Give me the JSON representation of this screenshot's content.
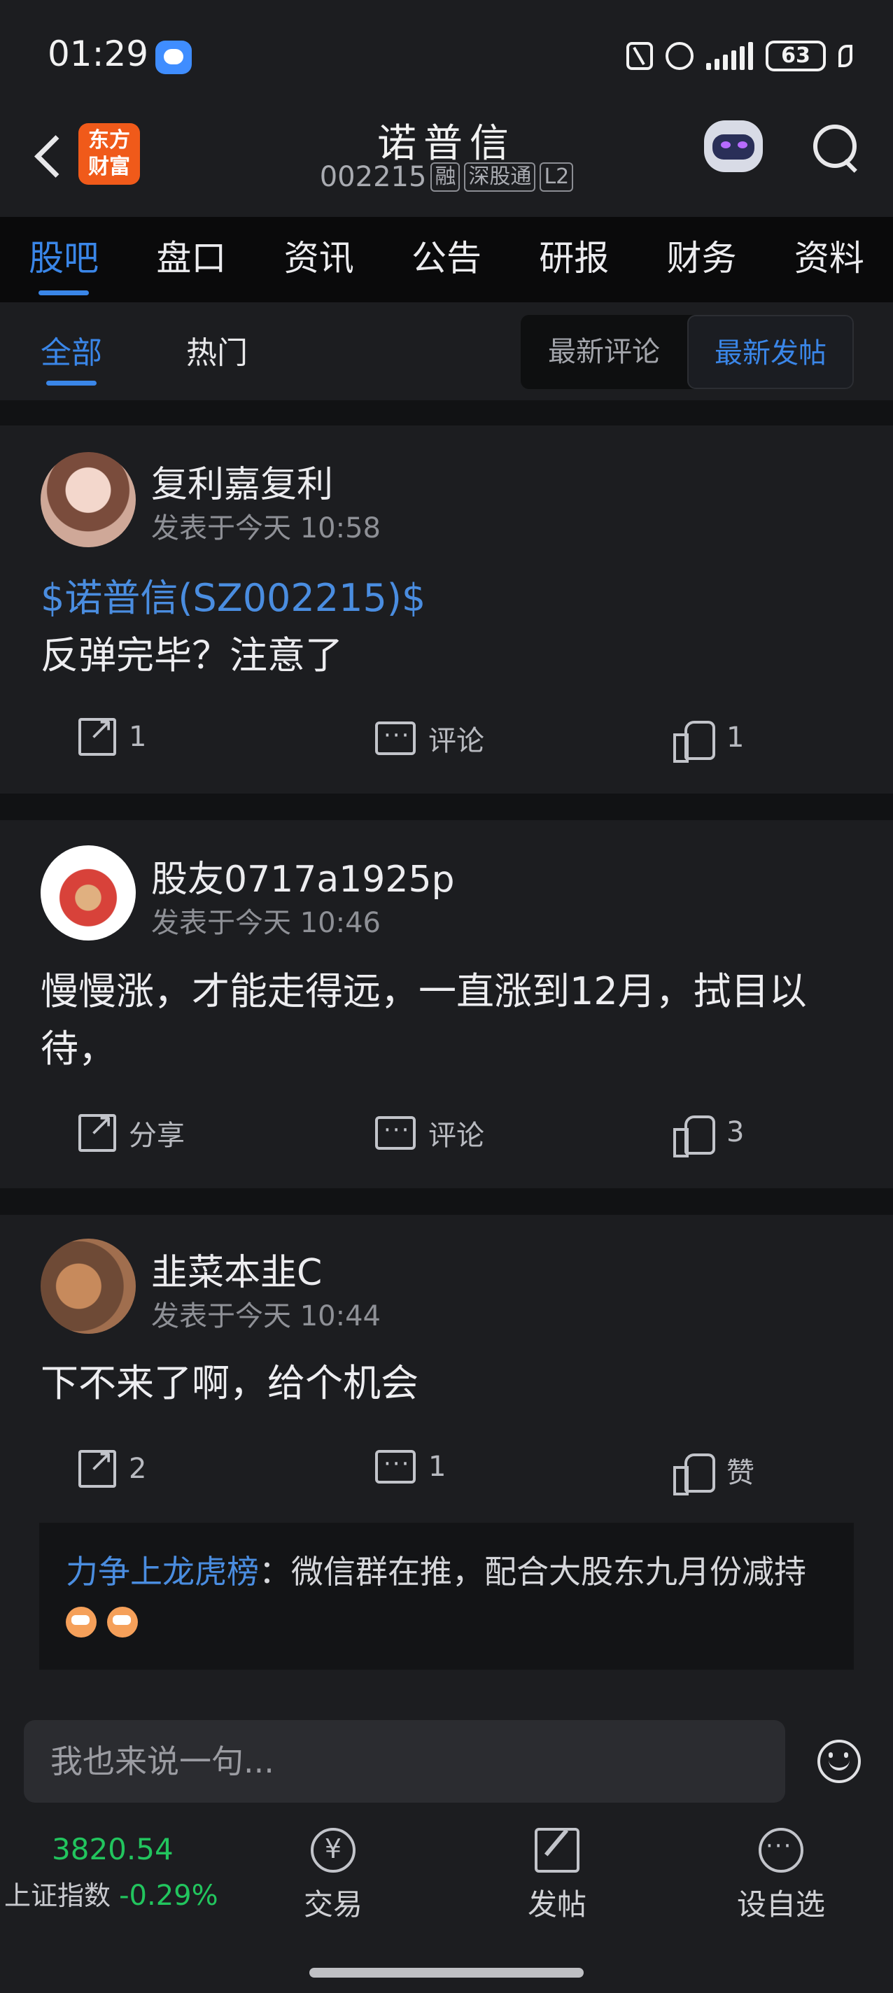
{
  "status_bar": {
    "time": "01:29",
    "battery": "63"
  },
  "header": {
    "logo_text": "东方财富",
    "stock_name": "诺普信",
    "stock_code": "002215",
    "tags": [
      "融",
      "深股通",
      "L2"
    ]
  },
  "main_tabs": [
    "股吧",
    "盘口",
    "资讯",
    "公告",
    "研报",
    "财务",
    "资料"
  ],
  "sub_tabs": {
    "all": "全部",
    "hot": "热门"
  },
  "sort_toggle": {
    "latest_comment": "最新评论",
    "latest_post": "最新发帖"
  },
  "posts": [
    {
      "author": "复利嘉复利",
      "time": "发表于今天 10:58",
      "stock_link": "$诺普信(SZ002215)$",
      "text": "反弹完毕？注意了",
      "share": "1",
      "comment": "评论",
      "like": "1"
    },
    {
      "author": "股友0717a1925p",
      "time": "发表于今天 10:46",
      "text": "慢慢涨，才能走得远，一直涨到12月，拭目以待，",
      "share": "分享",
      "comment": "评论",
      "like": "3"
    },
    {
      "author": "韭菜本韭C",
      "time": "发表于今天 10:44",
      "text": "下不来了啊，给个机会",
      "share": "2",
      "comment": "1",
      "like": "赞",
      "reply": {
        "user": "力争上龙虎榜",
        "text": "：微信群在推，配合大股东九月份减持"
      }
    }
  ],
  "comment_bar": {
    "placeholder": "我也来说一句..."
  },
  "bottom_bar": {
    "index_value": "3820.54",
    "index_name": "上证指数",
    "index_change": "-0.29%",
    "trade": "交易",
    "post": "发帖",
    "add_favorite": "设自选"
  },
  "colors": {
    "accent": "#3a86e8",
    "index_green": "#22c55e",
    "brand": "#f05a1a"
  }
}
